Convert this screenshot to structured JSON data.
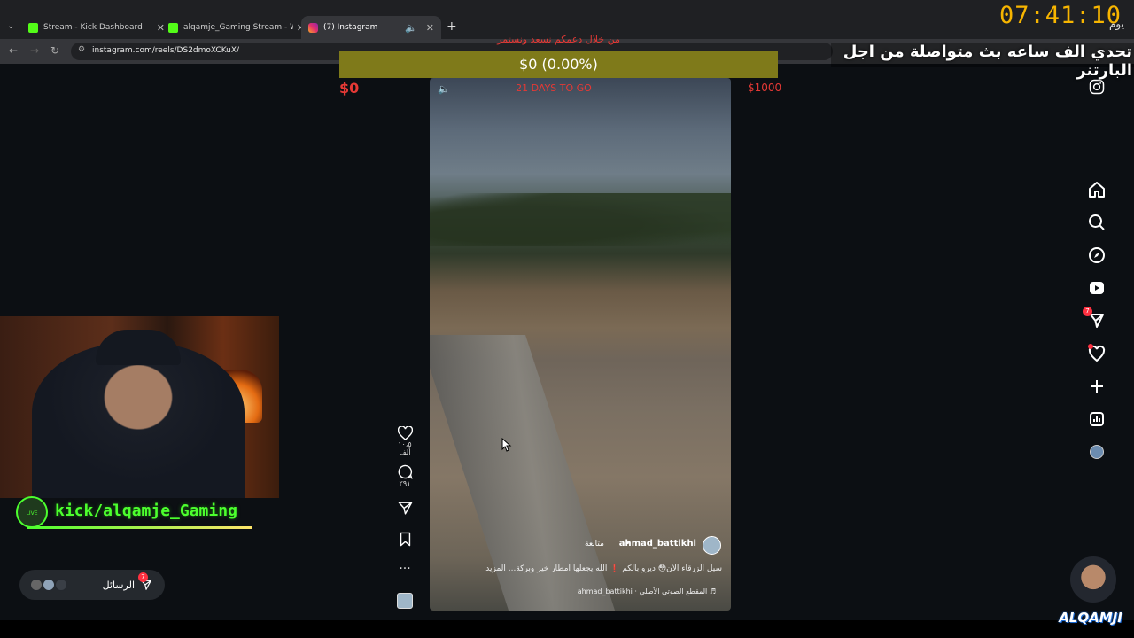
{
  "browser": {
    "tabs": [
      {
        "title": "Stream - Kick Dashboard",
        "favicon_color": "#53fc18"
      },
      {
        "title": "alqamje_Gaming Stream - Wat",
        "favicon_color": "#53fc18"
      },
      {
        "title": "(7) Instagram",
        "favicon_color": "#e1306c"
      }
    ],
    "new_tab_label": "+",
    "url": "instagram.com/reels/DS2dmoXCKuX/"
  },
  "overlay": {
    "goal_subtitle": "من خلال دعمكم نسعد ونستمر",
    "goal_amount": "$0 (0.00%)",
    "goal_min": "$0",
    "goal_max": "$1000",
    "goal_days": "21 DAYS TO GO",
    "goal_progress": 0,
    "clock": "07:41:10",
    "clock_label": "يوم",
    "challenge_text": "تحدي الف ساعه بث متواصلة من اجل البارتنر",
    "kick_handle": "kick/alqamje_Gaming",
    "kick_logo_text": "LIVE",
    "streamer_brand": "ALQAMJI"
  },
  "reel": {
    "likes": "١٠،٥ ألف",
    "comments": "٢٩١",
    "username": "ahmad_battikhi",
    "follow_label": "متابعة",
    "caption": "سيل الزرقاء الآن😳 ديرو بالكم ❗ الله يجعلها امطار خير وبركة... المزيد",
    "audio": "ahmad_battikhi · المقطع الصوتي الأصلي ♬"
  },
  "messages": {
    "label": "الرسائل",
    "badge": "7"
  },
  "nav": {
    "messages_badge": "7"
  }
}
